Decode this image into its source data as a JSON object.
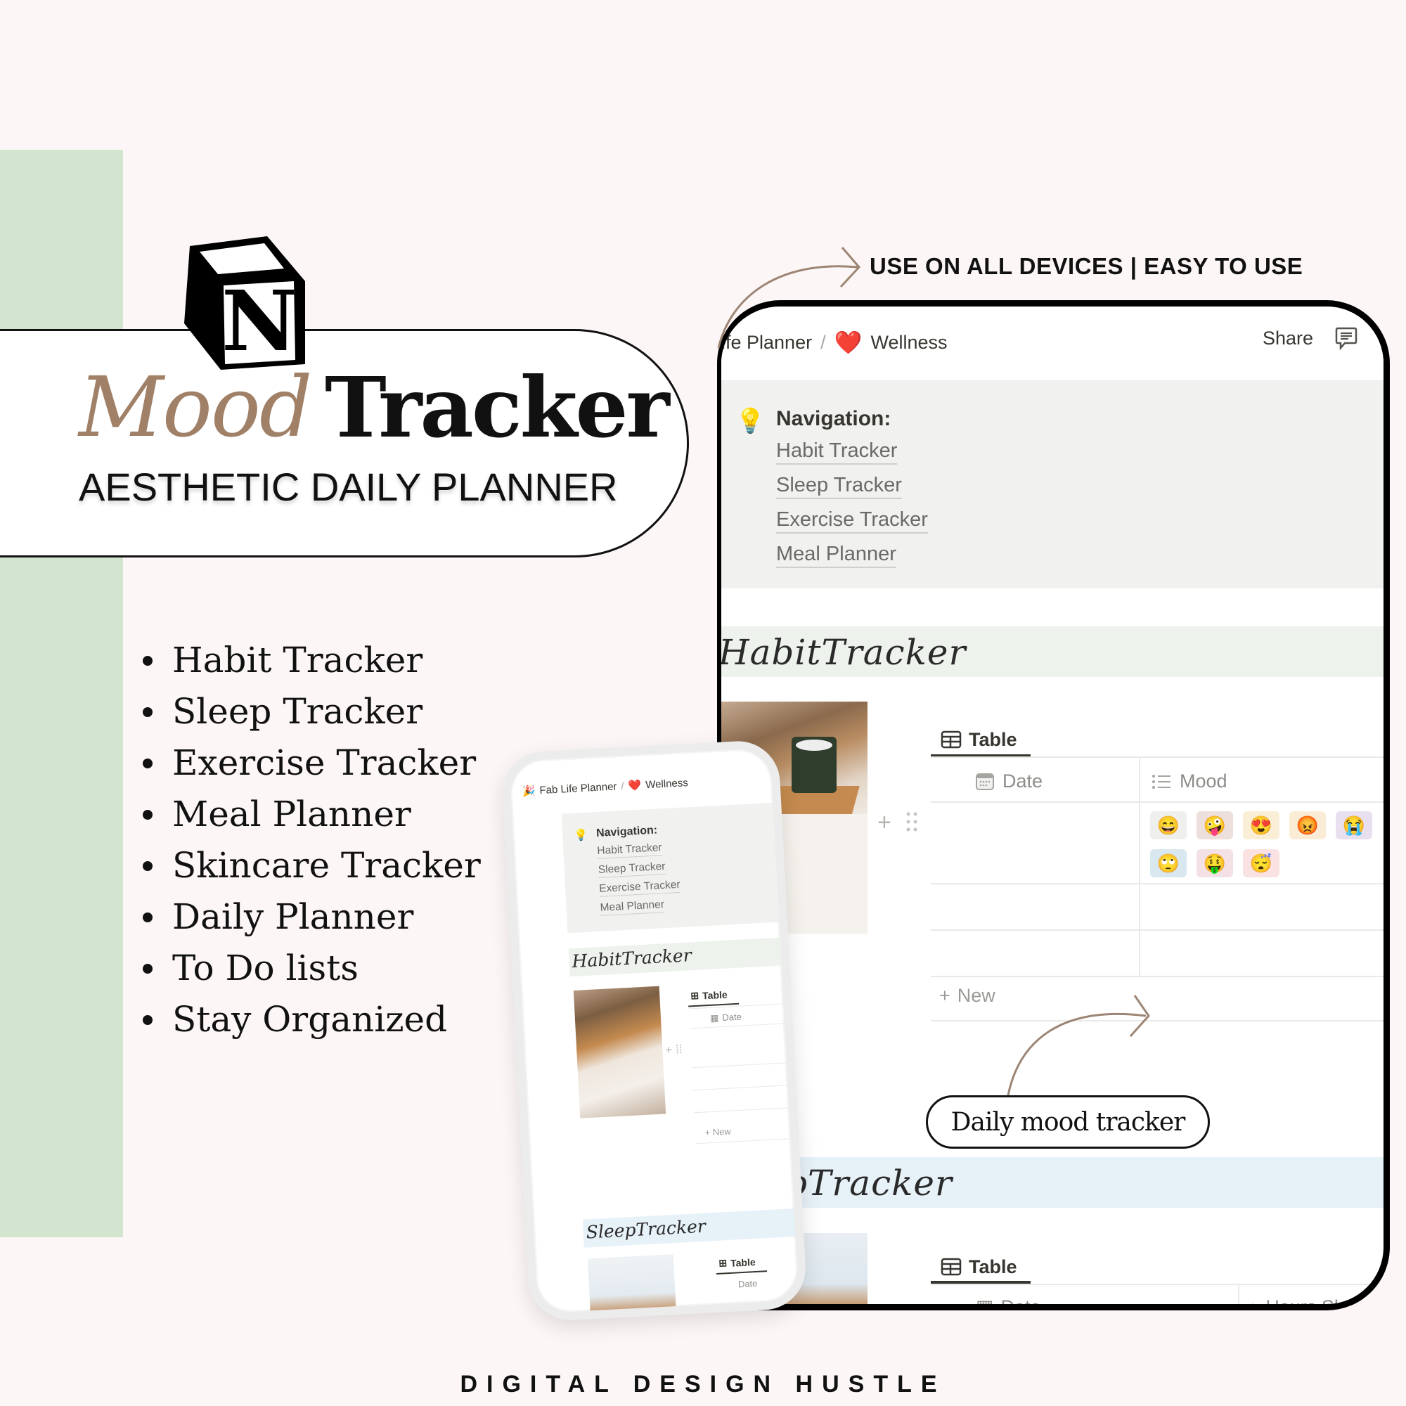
{
  "colors": {
    "background": "#fcf7f6",
    "green_band": "#d2e5cf",
    "accent_brown": "#a08067",
    "habit_banner": "#edf3ec",
    "sleep_banner": "#e7f1f8",
    "callout_bg": "#f1f1ef"
  },
  "hero": {
    "logo_letter": "N",
    "title_word1": "Mood",
    "title_word2": "Tracker",
    "subtitle": "AESTHETIC DAILY PLANNER"
  },
  "features": [
    "Habit Tracker",
    "Sleep Tracker",
    "Exercise Tracker",
    "Meal Planner",
    "Skincare Tracker",
    "Daily Planner",
    "To Do lists",
    "Stay Organized"
  ],
  "annotations": {
    "devices": "USE ON ALL DEVICES | EASY TO USE",
    "mood_callout": "Daily mood tracker"
  },
  "tablet": {
    "breadcrumb_parent": "ife Planner",
    "breadcrumb_sep": "/",
    "breadcrumb_icon": "❤️",
    "breadcrumb_current": "Wellness",
    "share_label": "Share",
    "callout": {
      "icon": "💡",
      "title": "Navigation:",
      "links": [
        "Habit Tracker",
        "Sleep Tracker",
        "Exercise Tracker",
        "Meal Planner"
      ]
    },
    "habit_section": {
      "title": "HabitTracker",
      "view_tab": "Table",
      "columns": [
        "Date",
        "Mood"
      ],
      "moods": [
        {
          "emoji": "😄",
          "bg": "#efefed"
        },
        {
          "emoji": "🤪",
          "bg": "#eddfdc"
        },
        {
          "emoji": "😍",
          "bg": "#fbeed6"
        },
        {
          "emoji": "😡",
          "bg": "#fbecd6"
        },
        {
          "emoji": "😭",
          "bg": "#e8e0ef"
        },
        {
          "emoji": "🙄",
          "bg": "#d9e7ef"
        },
        {
          "emoji": "🤑",
          "bg": "#f4e1e6"
        },
        {
          "emoji": "😴",
          "bg": "#fbe2e2"
        }
      ],
      "new_label": "New"
    },
    "sleep_section": {
      "title": "pTracker",
      "view_tab": "Table",
      "columns": [
        "Date",
        "Hours Sl"
      ]
    }
  },
  "phone": {
    "breadcrumb_icon": "🎉",
    "breadcrumb_parent": "Fab Life Planner",
    "breadcrumb_sep": "/",
    "breadcrumb_heart": "❤️",
    "breadcrumb_current": "Wellness",
    "callout": {
      "icon": "💡",
      "title": "Navigation:",
      "links": [
        "Habit Tracker",
        "Sleep Tracker",
        "Exercise Tracker",
        "Meal Planner"
      ]
    },
    "habit_title": "HabitTracker",
    "view_tab": "Table",
    "date_col": "Date",
    "new_label": "New",
    "sleep_title": "SleepTracker",
    "sleep_view_tab": "Table",
    "sleep_date_col": "Date"
  },
  "brand": "DIGITAL DESIGN HUSTLE"
}
